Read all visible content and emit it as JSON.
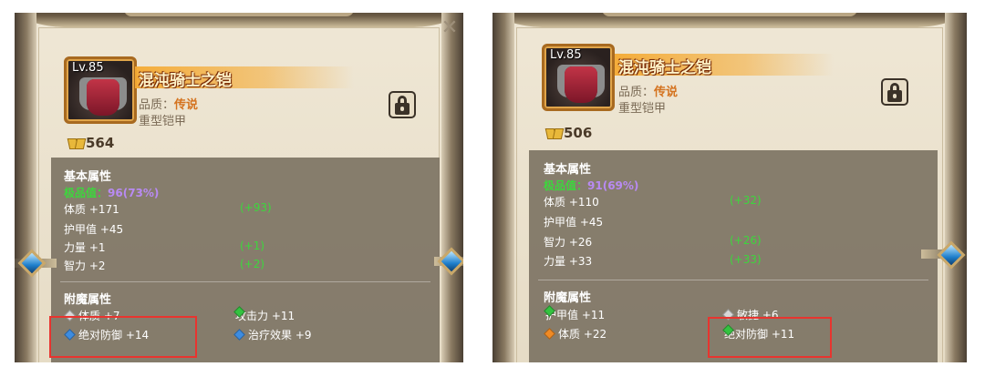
{
  "left": {
    "level": "Lv.85",
    "item_name": "混沌骑士之铠",
    "quality_label": "品质：",
    "quality_value": "传说",
    "item_type": "重型铠甲",
    "score": "564",
    "basic_title": "基本属性",
    "excellence_label": "极品值：",
    "excellence_value": "96(73%)",
    "basic_stats": [
      {
        "label": "体质 +171",
        "bonus": "(+93)"
      },
      {
        "label": "护甲值 +45",
        "bonus": ""
      },
      {
        "label": "力量 +1",
        "bonus": "(+1)"
      },
      {
        "label": "智力 +2",
        "bonus": "(+2)"
      }
    ],
    "enchant_title": "附魔属性",
    "enchant_stats": [
      {
        "label": "体质 +7",
        "gem": "silver"
      },
      {
        "label": "攻击力 +11",
        "gem": "green"
      },
      {
        "label": "绝对防御 +14",
        "gem": "blue"
      },
      {
        "label": "治疗效果 +9",
        "gem": "blue"
      }
    ]
  },
  "right": {
    "level": "Lv.85",
    "item_name": "混沌骑士之铠",
    "quality_label": "品质：",
    "quality_value": "传说",
    "item_type": "重型铠甲",
    "score": "506",
    "basic_title": "基本属性",
    "excellence_label": "极品值：",
    "excellence_value": "91(69%)",
    "basic_stats": [
      {
        "label": "体质 +110",
        "bonus": "(+32)"
      },
      {
        "label": "护甲值 +45",
        "bonus": ""
      },
      {
        "label": "智力 +26",
        "bonus": "(+26)"
      },
      {
        "label": "力量 +33",
        "bonus": "(+33)"
      }
    ],
    "enchant_title": "附魔属性",
    "enchant_stats": [
      {
        "label": "护甲值 +11",
        "gem": "green"
      },
      {
        "label": "敏捷 +6",
        "gem": "silver"
      },
      {
        "label": "体质 +22",
        "gem": "orange"
      },
      {
        "label": "绝对防御 +11",
        "gem": "green"
      }
    ]
  },
  "colors": {
    "highlight": "#e8342f",
    "bonus_green": "#3dd63d",
    "excellence_purple": "#b88af2",
    "quality_orange": "#d4721e"
  }
}
